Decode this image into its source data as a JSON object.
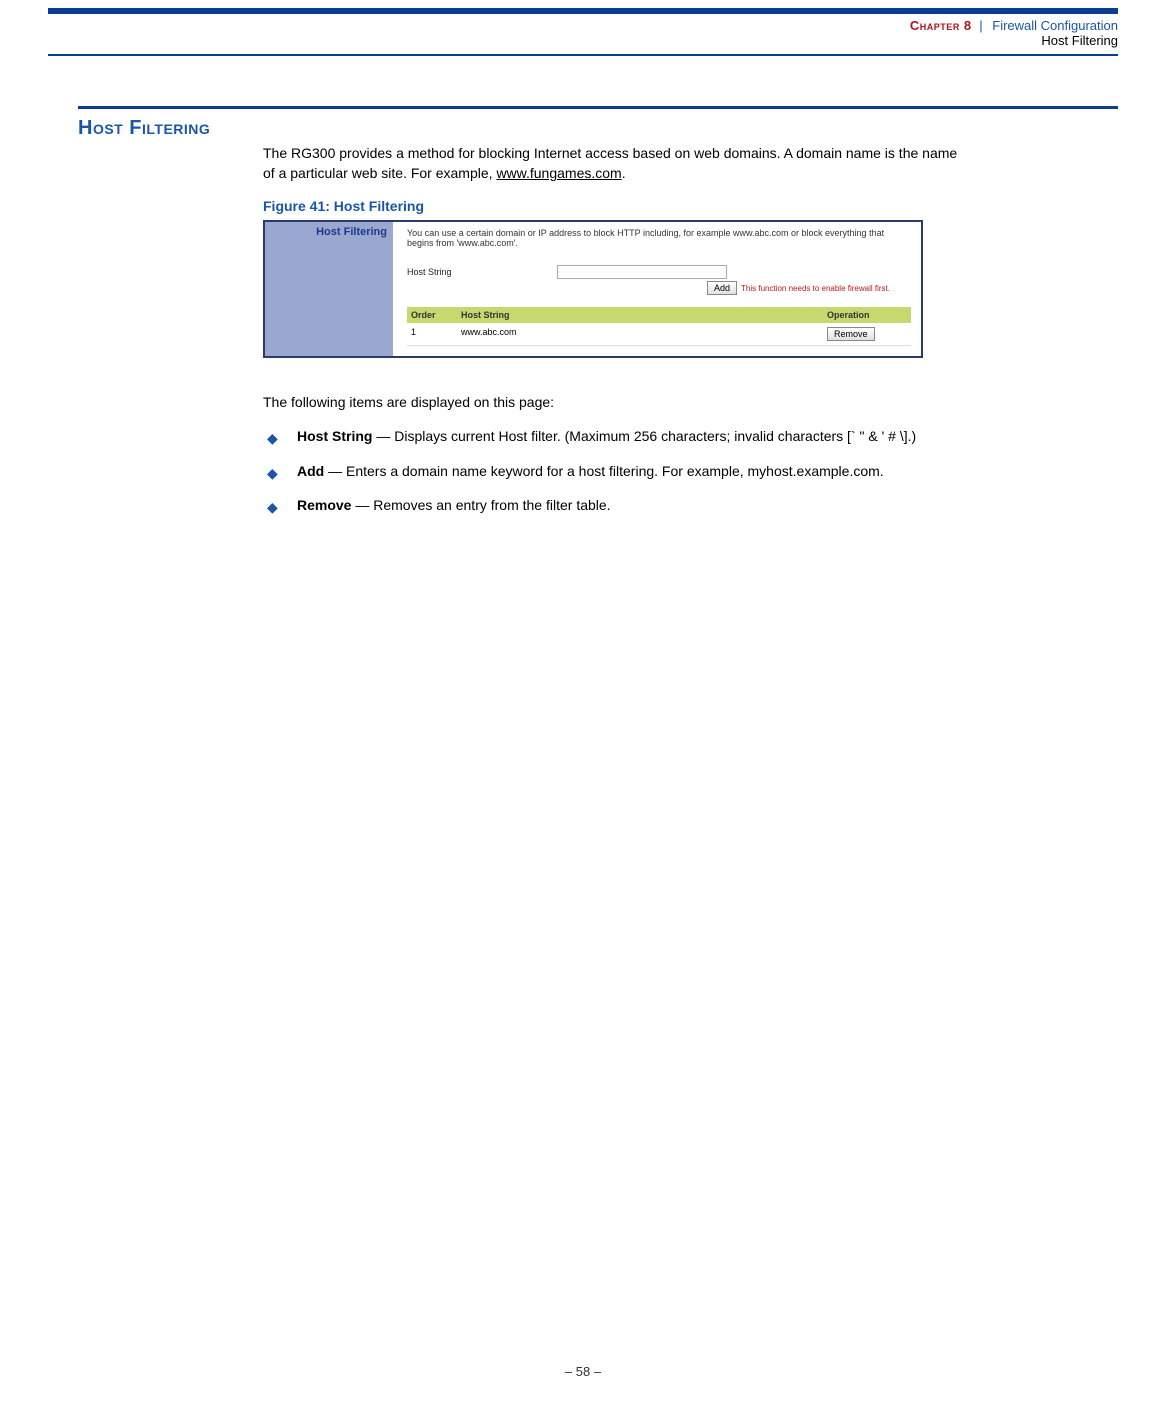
{
  "header": {
    "chapter_label": "Chapter 8",
    "chapter_title": "Firewall Configuration",
    "section_breadcrumb": "Host Filtering"
  },
  "section": {
    "heading": "Host Filtering",
    "intro_a": "The RG300 provides a method for blocking Internet access based on web domains. A domain name is the name of a particular web site. For example, ",
    "intro_link": "www.fungames.com",
    "intro_b": "."
  },
  "figure": {
    "caption": "Figure 41:  Host Filtering",
    "panel_title": "Host Filtering",
    "panel_desc": "You can use a certain domain or IP address to block HTTP including, for example www.abc.com or block everything that begins from 'www.abc.com'.",
    "form_label": "Host String",
    "add_btn": "Add",
    "warning": "This function needs to enable firewall first.",
    "table": {
      "col_order": "Order",
      "col_host": "Host String",
      "col_op": "Operation",
      "rows": [
        {
          "order": "1",
          "host": "www.abc.com",
          "op_btn": "Remove"
        }
      ]
    }
  },
  "following_items_intro": "The following items are displayed on this page:",
  "bullets": [
    {
      "term": "Host String",
      "desc": " — Displays current Host filter. (Maximum 256 characters; invalid characters [` \" & ' # \\].)"
    },
    {
      "term": "Add",
      "desc": " — Enters a domain name keyword for a host filtering. For example, myhost.example.com."
    },
    {
      "term": "Remove",
      "desc": " — Removes an entry from the filter table."
    }
  ],
  "footer": {
    "page_number": "–  58  –"
  }
}
